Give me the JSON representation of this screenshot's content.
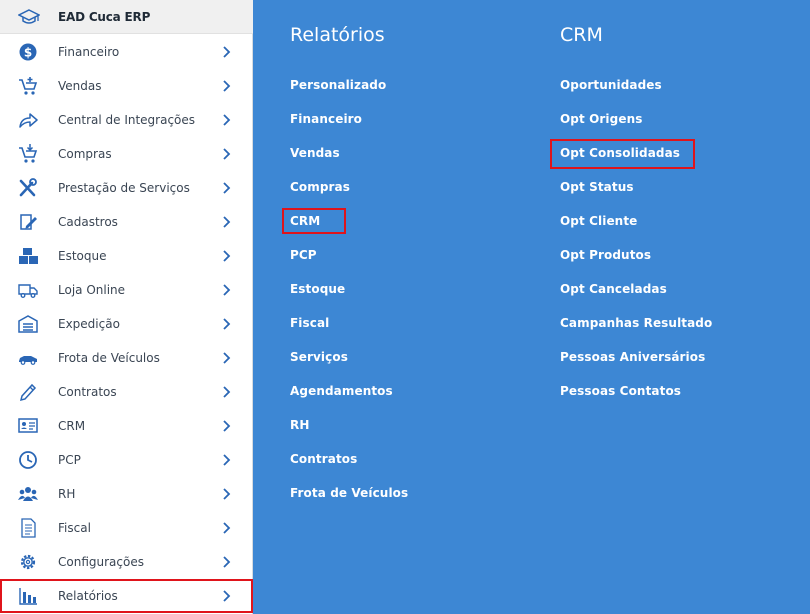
{
  "app": {
    "title": "EAD Cuca ERP",
    "logo_icon": "graduation-cap-icon"
  },
  "sidebar": {
    "items": [
      {
        "label": "Financeiro",
        "icon": "dollar-icon"
      },
      {
        "label": "Vendas",
        "icon": "cart-add-icon"
      },
      {
        "label": "Central de Integrações",
        "icon": "share-icon"
      },
      {
        "label": "Compras",
        "icon": "cart-down-icon"
      },
      {
        "label": "Prestação de Serviços",
        "icon": "tools-icon"
      },
      {
        "label": "Cadastros",
        "icon": "edit-icon"
      },
      {
        "label": "Estoque",
        "icon": "boxes-icon"
      },
      {
        "label": "Loja Online",
        "icon": "truck-icon"
      },
      {
        "label": "Expedição",
        "icon": "warehouse-icon"
      },
      {
        "label": "Frota de Veículos",
        "icon": "car-icon"
      },
      {
        "label": "Contratos",
        "icon": "pencil-icon"
      },
      {
        "label": "CRM",
        "icon": "id-card-icon"
      },
      {
        "label": "PCP",
        "icon": "clock-icon"
      },
      {
        "label": "RH",
        "icon": "users-icon"
      },
      {
        "label": "Fiscal",
        "icon": "document-icon"
      },
      {
        "label": "Configurações",
        "icon": "gear-icon"
      },
      {
        "label": "Relatórios",
        "icon": "bar-chart-icon"
      }
    ],
    "active_item": "Relatórios"
  },
  "relatorios": {
    "title": "Relatórios",
    "items": [
      "Personalizado",
      "Financeiro",
      "Vendas",
      "Compras",
      "CRM",
      "PCP",
      "Estoque",
      "Fiscal",
      "Serviços",
      "Agendamentos",
      "RH",
      "Contratos",
      "Frota de Veículos"
    ],
    "highlighted": "CRM"
  },
  "crm": {
    "title": "CRM",
    "items": [
      "Oportunidades",
      "Opt Origens",
      "Opt Consolidadas",
      "Opt Status",
      "Opt Cliente",
      "Opt Produtos",
      "Opt Canceladas",
      "Campanhas Resultado",
      "Pessoas Aniversários",
      "Pessoas Contatos"
    ],
    "highlighted": "Opt Consolidadas"
  },
  "colors": {
    "menu_background": "#3d87d4",
    "sidebar_background": "#ffffff",
    "icon_blue": "#2a66b5",
    "highlight_red": "#e0141b",
    "link_white": "#ffffff"
  }
}
